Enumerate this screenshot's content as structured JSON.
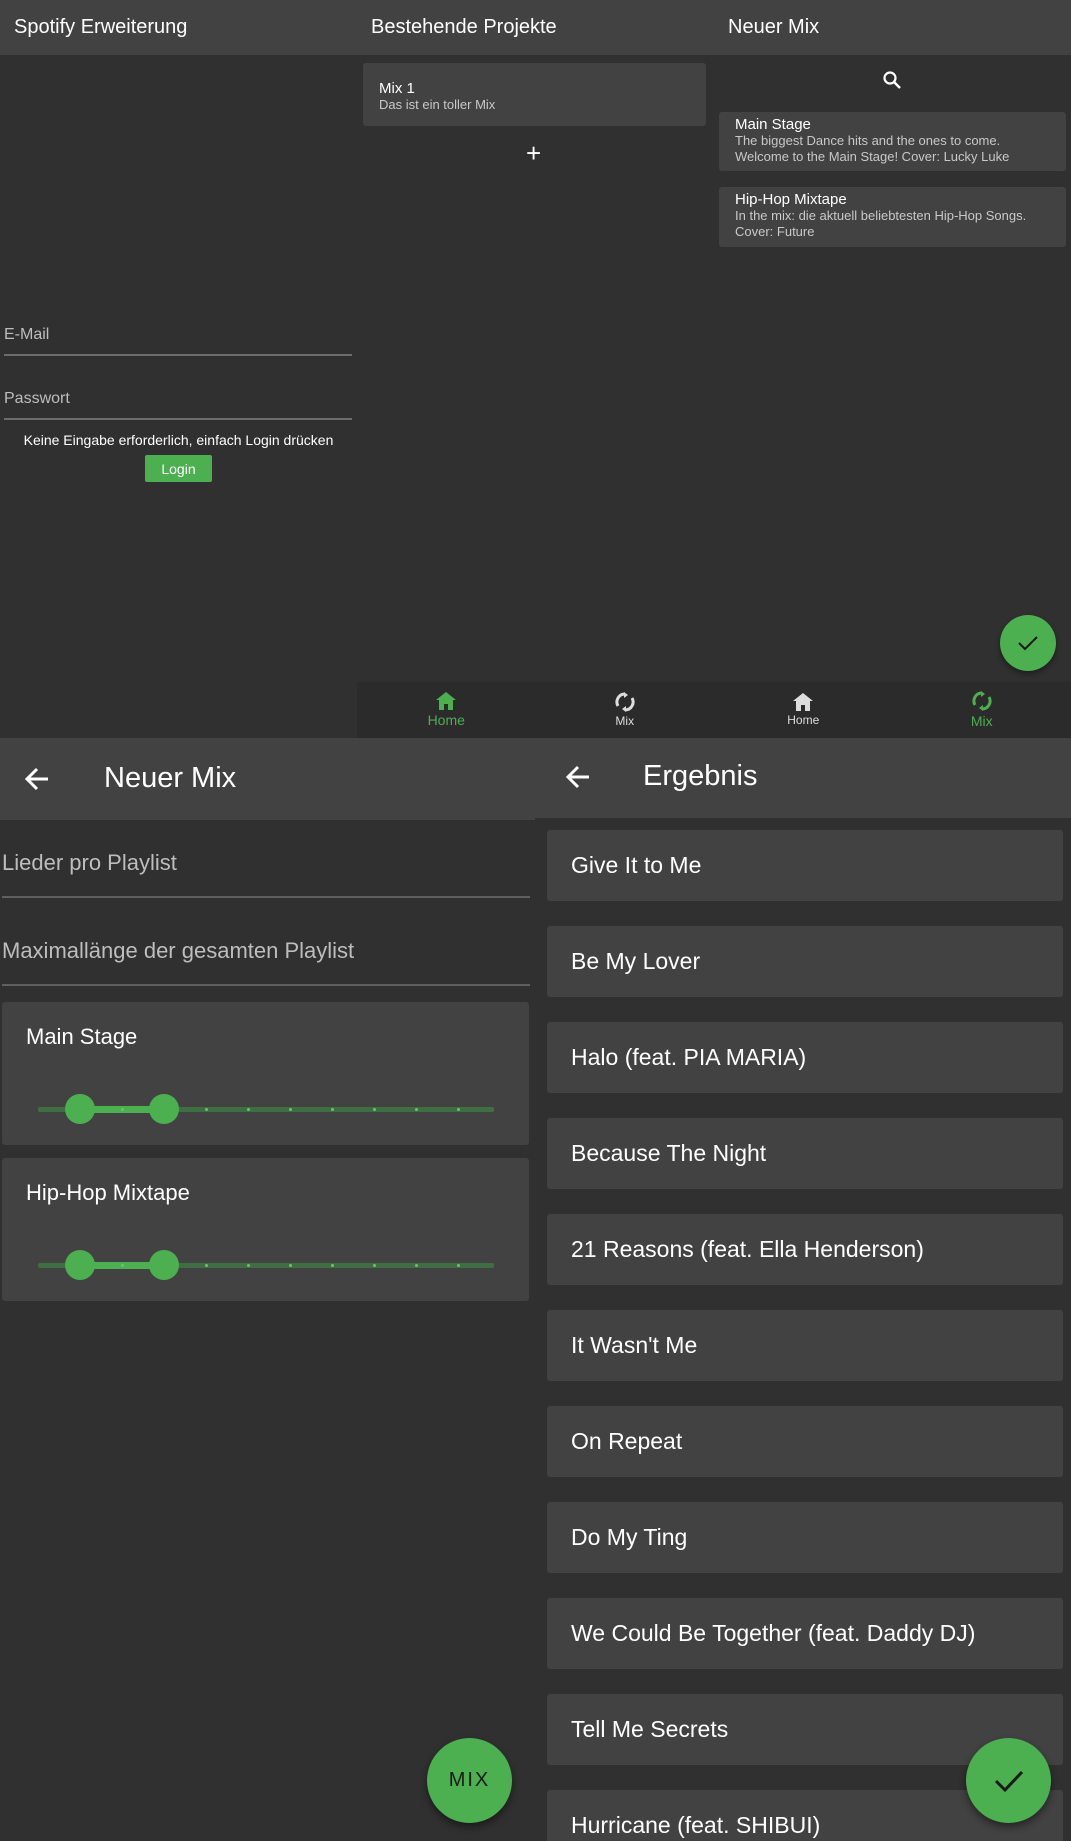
{
  "login": {
    "title": "Spotify Erweiterung",
    "email_placeholder": "E-Mail",
    "password_placeholder": "Passwort",
    "hint": "Keine Eingabe erforderlich, einfach Login drücken",
    "login_label": "Login"
  },
  "projects": {
    "title": "Bestehende Projekte",
    "items": [
      {
        "title": "Mix 1",
        "subtitle": "Das ist ein toller Mix"
      }
    ],
    "add_label": "+",
    "nav": {
      "home_label": "Home",
      "mix_label": "Mix",
      "active": "home"
    }
  },
  "new_mix": {
    "title": "Neuer Mix",
    "playlists": [
      {
        "title": "Main Stage",
        "line1": "The biggest Dance hits and the ones to come.",
        "line2": "Welcome to the Main Stage! Cover: Lucky Luke"
      },
      {
        "title": "Hip-Hop Mixtape",
        "line1": "In the mix: die aktuell beliebtesten Hip-Hop Songs.",
        "line2": "Cover: Future"
      }
    ],
    "nav": {
      "home_label": "Home",
      "mix_label": "Mix",
      "active": "mix"
    }
  },
  "mix_settings": {
    "title": "Neuer Mix",
    "songs_per_playlist_placeholder": "Lieder pro Playlist",
    "max_length_placeholder": "Maximallänge der gesamten Playlist",
    "sliders": [
      {
        "label": "Main Stage",
        "range_start_step": 1,
        "range_end_step": 3,
        "steps": 10
      },
      {
        "label": "Hip-Hop Mixtape",
        "range_start_step": 1,
        "range_end_step": 3,
        "steps": 10
      }
    ],
    "fab_label": "MIX"
  },
  "result": {
    "title": "Ergebnis",
    "songs": [
      "Give It to Me",
      "Be My Lover",
      "Halo (feat. PIA MARIA)",
      "Because The Night",
      "21 Reasons (feat. Ella Henderson)",
      "It Wasn't Me",
      "On Repeat",
      "Do My Ting",
      "We Could Be Together (feat. Daddy DJ)",
      "Tell Me Secrets",
      "Hurricane (feat. SHIBUI)"
    ]
  },
  "colors": {
    "accent": "#4caf50",
    "background": "#303030",
    "surface": "#424242"
  }
}
